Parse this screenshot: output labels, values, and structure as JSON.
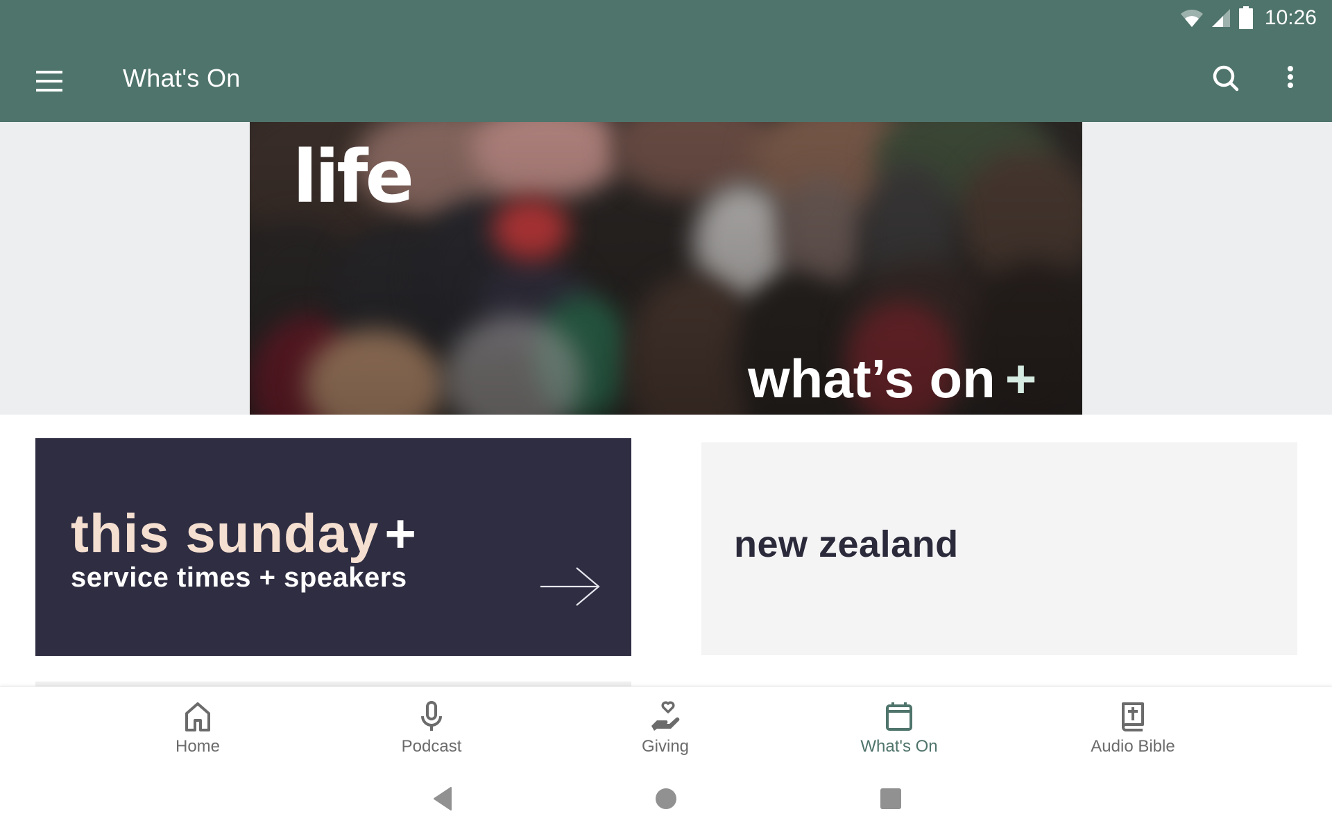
{
  "status_bar": {
    "time": "10:26",
    "icons": [
      "wifi-icon",
      "cell-signal-icon",
      "battery-icon"
    ]
  },
  "toolbar": {
    "title": "What's On",
    "menu_icon": "hamburger-menu-icon",
    "search_icon": "search-icon",
    "more_icon": "more-vert-icon"
  },
  "hero": {
    "logo_text": "life",
    "caption": "what’s on",
    "caption_plus": "+"
  },
  "cards": [
    {
      "title": "this sunday",
      "title_plus": "+",
      "subtitle": "service times + speakers",
      "icon": "arrow-right-icon",
      "colors": {
        "background": "#2e2d42",
        "title": "#f5dfd0",
        "subtitle": "#ffffff"
      }
    },
    {
      "title": "new zealand",
      "colors": {
        "background": "#f4f4f5",
        "title": "#2a2a3b"
      }
    }
  ],
  "bottom_nav": {
    "items": [
      {
        "label": "Home",
        "icon": "home-icon",
        "active": false
      },
      {
        "label": "Podcast",
        "icon": "microphone-icon",
        "active": false
      },
      {
        "label": "Giving",
        "icon": "giving-hand-heart-icon",
        "active": false
      },
      {
        "label": "What's On",
        "icon": "calendar-icon",
        "active": true
      },
      {
        "label": "Audio Bible",
        "icon": "bible-icon",
        "active": false
      }
    ]
  },
  "system_nav": {
    "buttons": [
      "back-icon",
      "home-circle-icon",
      "recents-icon"
    ]
  },
  "colors": {
    "primary": "#4f746b",
    "active_tab": "#4f746b",
    "inactive_tab": "#6b6b6b",
    "hero_plus": "#d6ebe1"
  }
}
